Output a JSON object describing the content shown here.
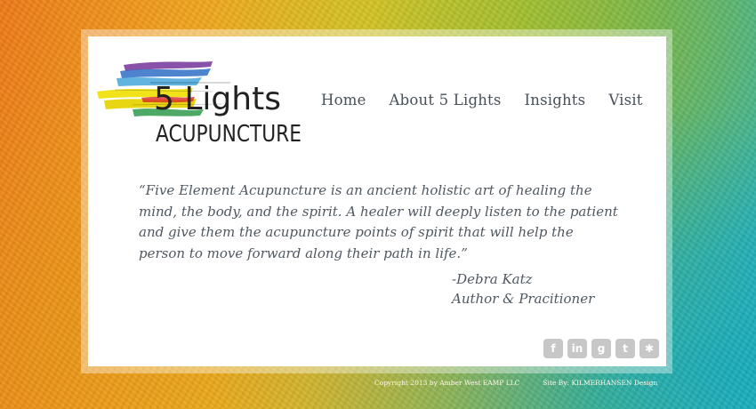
{
  "logo": {
    "line1": "5 Lights",
    "line2": "ACUPUNCTURE",
    "brush_colors": [
      "#7b3fa0",
      "#2f6fc4",
      "#3aa0d8",
      "#f1e21a",
      "#e8d612",
      "#2e9a4a",
      "#d92a2a"
    ]
  },
  "nav": {
    "items": [
      "Home",
      "About 5 Lights",
      "Insights",
      "Visit"
    ]
  },
  "quote": {
    "text": "“Five Element Acupuncture is an ancient holistic art of healing the mind, the body, and the spirit. A healer will deeply listen to the patient and give them the acupuncture points of spirit that will help the person to move forward along their path in life.”",
    "author": "-Debra Katz",
    "role": "Author & Pracitioner"
  },
  "social": [
    {
      "icon": "facebook-icon",
      "glyph": "f"
    },
    {
      "icon": "linkedin-icon",
      "glyph": "in"
    },
    {
      "icon": "google-plus-icon",
      "glyph": "g"
    },
    {
      "icon": "twitter-icon",
      "glyph": "t"
    },
    {
      "icon": "yelp-icon",
      "glyph": "✱"
    }
  ],
  "footer": {
    "copyright": "Copyright 2013 by Amber West EAMP LLC",
    "credit": "Site By: KILMERHANSEN Design"
  },
  "colors": {
    "text": "#4f5861",
    "nav": "#48505a",
    "social_bg": "#c7c7c7",
    "card_bg": "#ffffff"
  }
}
